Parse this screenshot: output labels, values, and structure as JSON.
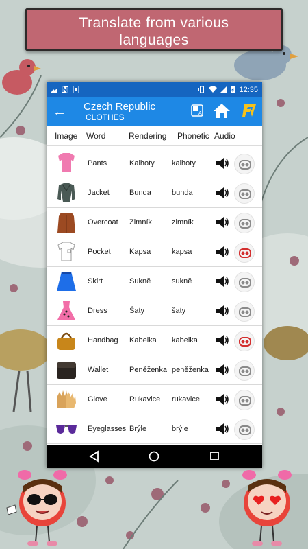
{
  "banner": {
    "line1": "Translate from various",
    "line2": "languages"
  },
  "status": {
    "time": "12:35"
  },
  "appbar": {
    "title": "Czech Republic",
    "subtitle": "CLOTHES"
  },
  "columns": {
    "image": "Image",
    "word": "Word",
    "rendering": "Rendering",
    "phonetic": "Phonetic",
    "audio": "Audio"
  },
  "rows": [
    {
      "word": "Pants",
      "rendering": "Kalhoty",
      "phonetic": "kalhoty",
      "recorded": false
    },
    {
      "word": "Jacket",
      "rendering": "Bunda",
      "phonetic": "bunda",
      "recorded": false
    },
    {
      "word": "Overcoat",
      "rendering": "Zimník",
      "phonetic": "zimník",
      "recorded": false
    },
    {
      "word": "Pocket",
      "rendering": "Kapsa",
      "phonetic": "kapsa",
      "recorded": true
    },
    {
      "word": "Skirt",
      "rendering": "Sukně",
      "phonetic": "sukně",
      "recorded": false
    },
    {
      "word": "Dress",
      "rendering": "Šaty",
      "phonetic": "šaty",
      "recorded": false
    },
    {
      "word": "Handbag",
      "rendering": "Kabelka",
      "phonetic": "kabelka",
      "recorded": true
    },
    {
      "word": "Wallet",
      "rendering": "Peněženka",
      "phonetic": "peněženka",
      "recorded": false
    },
    {
      "word": "Glove",
      "rendering": "Rukavice",
      "phonetic": "rukavice",
      "recorded": false
    },
    {
      "word": "Eyeglasses",
      "rendering": "Brýle",
      "phonetic": "brýle",
      "recorded": false
    }
  ],
  "colors": {
    "statusbar": "#1565c0",
    "appbar": "#1e88e5",
    "banner": "#c06772",
    "recorded_icon": "#d32f2f",
    "idle_icon": "#8a8a8a"
  }
}
